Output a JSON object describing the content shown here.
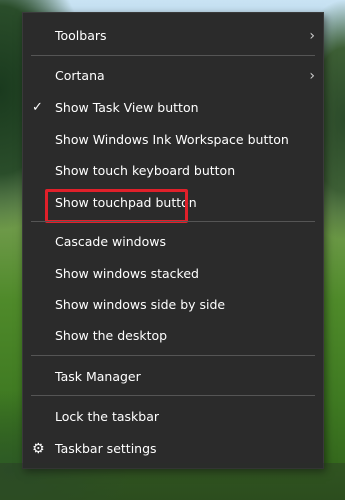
{
  "menu": {
    "items": [
      {
        "label": "Toolbars",
        "submenu": true
      },
      {
        "label": "Cortana",
        "submenu": true
      },
      {
        "label": "Show Task View button",
        "checked": true
      },
      {
        "label": "Show Windows Ink Workspace button"
      },
      {
        "label": "Show touch keyboard button"
      },
      {
        "label": "Show touchpad button",
        "highlighted": true
      },
      {
        "label": "Cascade windows"
      },
      {
        "label": "Show windows stacked"
      },
      {
        "label": "Show windows side by side"
      },
      {
        "label": "Show the desktop"
      },
      {
        "label": "Task Manager"
      },
      {
        "label": "Lock the taskbar"
      },
      {
        "label": "Taskbar settings",
        "icon": "gear-icon"
      }
    ],
    "submenu_glyph": "›",
    "check_glyph": "✓",
    "gear_glyph": "⚙"
  },
  "colors": {
    "menu_background": "#2b2b2b",
    "separator": "#555555",
    "highlight_box": "#e0202a",
    "text": "#ffffff"
  }
}
